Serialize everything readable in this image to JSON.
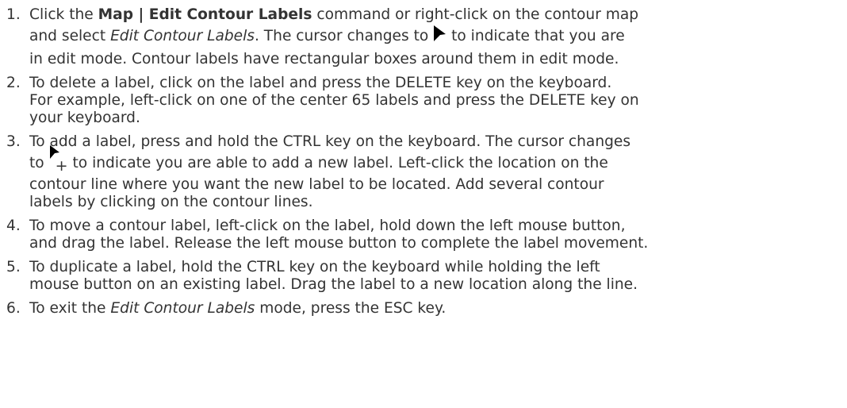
{
  "steps": [
    {
      "number": "1.",
      "a1": "Click the ",
      "a2": "Map | Edit Contour Labels",
      "a3": " command or right-click on the contour map",
      "b1": "and select ",
      "b2": "Edit Contour Labels",
      "b3": ". The cursor changes to ",
      "b4": " to indicate that you are",
      "c": "in edit mode. Contour labels have rectangular boxes around them in edit mode."
    },
    {
      "number": "2.",
      "a": "To delete a label, click on the label and press the DELETE key on the keyboard.",
      "b": "For example, left-click on one of the center 65 labels and press the DELETE key on",
      "c": "your keyboard."
    },
    {
      "number": "3.",
      "a": "To add a label, press and hold the CTRL key on the keyboard. The cursor changes",
      "b1": "to ",
      "b2": "+",
      "b3": " to indicate you are able to add a new label. Left-click the location on the",
      "c": "contour line where you want the new label to be located. Add several contour",
      "d": "labels by clicking on the contour lines."
    },
    {
      "number": "4.",
      "a": "To move a contour label, left-click on the label, hold down the left mouse button,",
      "b": "and drag the label. Release the left mouse button to complete the label movement."
    },
    {
      "number": "5.",
      "a": "To duplicate a label, hold the CTRL key on the keyboard while holding the left",
      "b": "mouse button on an existing label. Drag the label to a new location along the line."
    },
    {
      "number": "6.",
      "a1": "To exit the ",
      "a2": "Edit Contour Labels",
      "a3": " mode, press the ESC key."
    }
  ],
  "icons": {
    "edit_cursor": "arrow-cursor-icon",
    "add_cursor": "arrow-plus-cursor-icon"
  }
}
